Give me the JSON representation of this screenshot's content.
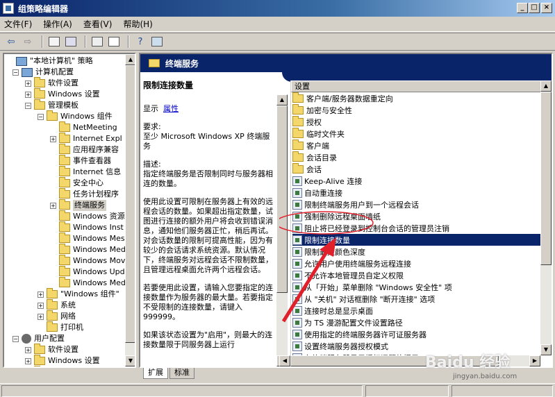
{
  "window": {
    "title": "组策略编辑器"
  },
  "menu": [
    "文件(F)",
    "操作(A)",
    "查看(V)",
    "帮助(H)"
  ],
  "tree": [
    {
      "label": "\"本地计算机\" 策略",
      "depth": 0,
      "icon": "policy-icon",
      "toggle": ""
    },
    {
      "label": "计算机配置",
      "depth": 1,
      "icon": "computer-icon",
      "toggle": "−"
    },
    {
      "label": "软件设置",
      "depth": 2,
      "icon": "folder-icon",
      "toggle": "+"
    },
    {
      "label": "Windows 设置",
      "depth": 2,
      "icon": "folder-icon",
      "toggle": "+"
    },
    {
      "label": "管理模板",
      "depth": 2,
      "icon": "folder-icon",
      "toggle": "−"
    },
    {
      "label": "Windows 组件",
      "depth": 3,
      "icon": "folder-icon",
      "toggle": "−"
    },
    {
      "label": "NetMeeting",
      "depth": 4,
      "icon": "folder-icon",
      "toggle": ""
    },
    {
      "label": "Internet Expl",
      "depth": 4,
      "icon": "folder-icon",
      "toggle": "+"
    },
    {
      "label": "应用程序兼容",
      "depth": 4,
      "icon": "folder-icon",
      "toggle": ""
    },
    {
      "label": "事件查看器",
      "depth": 4,
      "icon": "folder-icon",
      "toggle": ""
    },
    {
      "label": "Internet 信息",
      "depth": 4,
      "icon": "folder-icon",
      "toggle": ""
    },
    {
      "label": "安全中心",
      "depth": 4,
      "icon": "folder-icon",
      "toggle": ""
    },
    {
      "label": "任务计划程序",
      "depth": 4,
      "icon": "folder-icon",
      "toggle": ""
    },
    {
      "label": "终端服务",
      "depth": 4,
      "icon": "folder-icon",
      "toggle": "+",
      "selected": true
    },
    {
      "label": "Windows 资源",
      "depth": 4,
      "icon": "folder-icon",
      "toggle": ""
    },
    {
      "label": "Windows Inst",
      "depth": 4,
      "icon": "folder-icon",
      "toggle": ""
    },
    {
      "label": "Windows Mess",
      "depth": 4,
      "icon": "folder-icon",
      "toggle": ""
    },
    {
      "label": "Windows Medi",
      "depth": 4,
      "icon": "folder-icon",
      "toggle": ""
    },
    {
      "label": "Windows Movi",
      "depth": 4,
      "icon": "folder-icon",
      "toggle": ""
    },
    {
      "label": "Windows Upda",
      "depth": 4,
      "icon": "folder-icon",
      "toggle": ""
    },
    {
      "label": "Windows Medi",
      "depth": 4,
      "icon": "folder-icon",
      "toggle": ""
    },
    {
      "label": "\"Windows 组件\"",
      "depth": 3,
      "icon": "folder-icon",
      "toggle": "+"
    },
    {
      "label": "系统",
      "depth": 3,
      "icon": "folder-icon",
      "toggle": "+"
    },
    {
      "label": "网络",
      "depth": 3,
      "icon": "folder-icon",
      "toggle": "+"
    },
    {
      "label": "打印机",
      "depth": 3,
      "icon": "folder-icon",
      "toggle": ""
    },
    {
      "label": "用户配置",
      "depth": 1,
      "icon": "user-icon",
      "toggle": "−"
    },
    {
      "label": "软件设置",
      "depth": 2,
      "icon": "folder-icon",
      "toggle": "+"
    },
    {
      "label": "Windows 设置",
      "depth": 2,
      "icon": "folder-icon",
      "toggle": "+"
    },
    {
      "label": "管理模板",
      "depth": 2,
      "icon": "folder-icon",
      "toggle": "+"
    }
  ],
  "right": {
    "header": "终端服务",
    "desc": {
      "title": "限制连接数量",
      "show_label": "显示",
      "show_link": "属性",
      "req": "要求:\n至少 Microsoft Windows XP 终端服务",
      "desc": "描述:\n指定终端服务是否限制同时与服务器相连的数量。",
      "p1": "使用此设置可限制在服务器上有效的远程会话的数量。如果超出指定数量，试图进行连接的额外用户将会收到错误消息，通知他们服务器正忙，稍后再试。对会话数量的限制可提高性能，因为有较少的会话请求系统资源。默认情况下，终端服务对远程会话不限制数量，且管理远程桌面允许两个远程会话。",
      "p2": "若要使用此设置，请输入您要指定的连接数量作为服务器的最大量。若要指定不受限制的连接数量，请键入 999999。",
      "p3": "如果该状态设置为\"启用\"，则最大的连接数量限于同服务器上运行"
    },
    "list_header": "设置",
    "items": [
      {
        "label": "客户端/服务器数据重定向",
        "type": "folder"
      },
      {
        "label": "加密与安全性",
        "type": "folder"
      },
      {
        "label": "授权",
        "type": "folder"
      },
      {
        "label": "临时文件夹",
        "type": "folder"
      },
      {
        "label": "客户端",
        "type": "folder"
      },
      {
        "label": "会话目录",
        "type": "folder"
      },
      {
        "label": "会话",
        "type": "folder"
      },
      {
        "label": "Keep-Alive 连接",
        "type": "setting"
      },
      {
        "label": "自动重连接",
        "type": "setting"
      },
      {
        "label": "限制终端服务用户到一个远程会话",
        "type": "setting"
      },
      {
        "label": "强制删除远程桌面墙纸",
        "type": "setting"
      },
      {
        "label": "阻止将已经登录到控制台会话的管理员注销",
        "type": "setting"
      },
      {
        "label": "限制连接数量",
        "type": "setting",
        "selected": true
      },
      {
        "label": "限制最大颜色深度",
        "type": "setting"
      },
      {
        "label": "允许用户使用终端服务远程连接",
        "type": "setting"
      },
      {
        "label": "不允许本地管理员自定义权限",
        "type": "setting"
      },
      {
        "label": "从「开始」菜单删除 \"Windows 安全性\" 项",
        "type": "setting"
      },
      {
        "label": "从 \"关机\" 对话框删除 \"断开连接\" 选项",
        "type": "setting"
      },
      {
        "label": "连接时总是显示桌面",
        "type": "setting"
      },
      {
        "label": "为 TS 漫游配置文件设置路径",
        "type": "setting"
      },
      {
        "label": "使用指定的终端服务器许可证服务器",
        "type": "setting"
      },
      {
        "label": "设置终端服务器授权模式",
        "type": "setting"
      },
      {
        "label": "在终端服务器显示授权问题的提示",
        "type": "setting"
      }
    ]
  },
  "tabs": [
    "扩展",
    "标准"
  ],
  "watermark": {
    "brand": "Baidu 经验",
    "url": "jingyan.baidu.com"
  },
  "colors": {
    "title_bar": "#0a246a",
    "selection": "#0a246a",
    "annotation": "#e0202a"
  }
}
